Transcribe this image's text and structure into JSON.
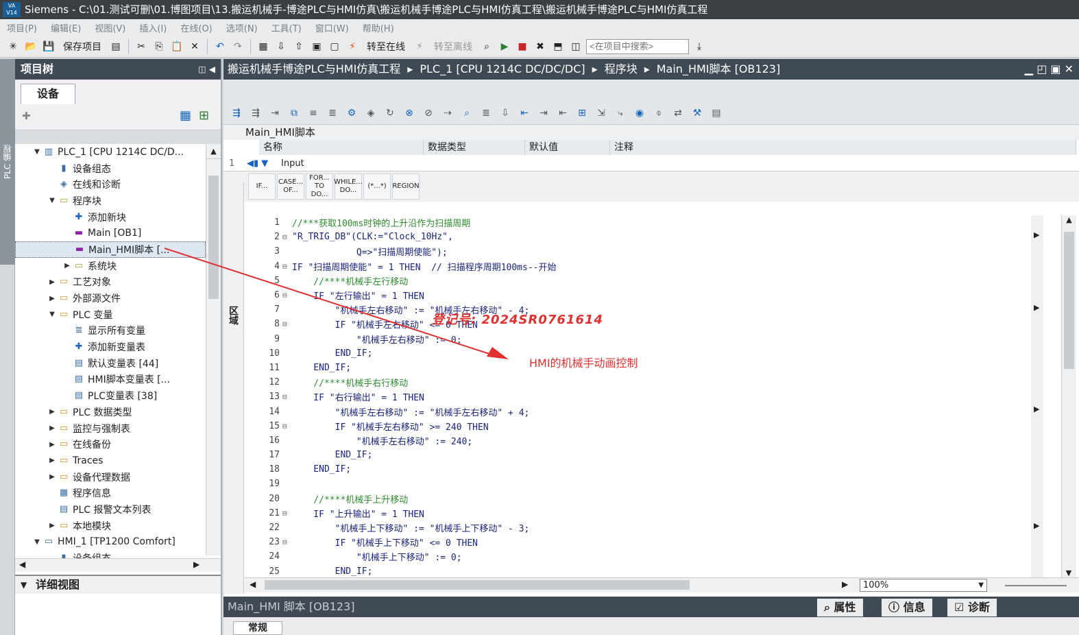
{
  "window": {
    "app_icon": "VA V14",
    "title": "Siemens  -  C:\\01.测试可删\\01.博图项目\\13.搬运机械手-博途PLC与HMI仿真\\搬运机械手博途PLC与HMI仿真工程\\搬运机械手博途PLC与HMI仿真工程"
  },
  "menu": [
    "项目(P)",
    "编辑(E)",
    "视图(V)",
    "插入(I)",
    "在线(O)",
    "选项(N)",
    "工具(T)",
    "窗口(W)",
    "帮助(H)"
  ],
  "toolbar": {
    "save_project": "保存项目",
    "go_online": "转至在线",
    "go_offline": "转至离线",
    "search_placeholder": "<在项目中搜索>"
  },
  "side_tab": "PLC 编程",
  "project_tree": {
    "title": "项目树",
    "device_tab": "设备",
    "items": [
      {
        "label": "PLC_1 [CPU 1214C DC/D...",
        "icon": "plc-icon",
        "arrow": "▼",
        "level": 0
      },
      {
        "label": "设备组态",
        "icon": "device-config-icon",
        "arrow": "",
        "level": 1
      },
      {
        "label": "在线和诊断",
        "icon": "diagnostics-icon",
        "arrow": "",
        "level": 1
      },
      {
        "label": "程序块",
        "icon": "folder-icon",
        "arrow": "▼",
        "level": 1
      },
      {
        "label": "添加新块",
        "icon": "add-block-icon",
        "arrow": "",
        "level": 2
      },
      {
        "label": "Main [OB1]",
        "icon": "ob-icon",
        "arrow": "",
        "level": 2
      },
      {
        "label": "Main_HMI脚本 [...",
        "icon": "ob-icon",
        "arrow": "",
        "level": 2,
        "selected": true
      },
      {
        "label": "系统块",
        "icon": "folder-icon",
        "arrow": "▶",
        "level": 2
      },
      {
        "label": "工艺对象",
        "icon": "folder-icon",
        "arrow": "▶",
        "level": 1
      },
      {
        "label": "外部源文件",
        "icon": "folder-icon",
        "arrow": "▶",
        "level": 1
      },
      {
        "label": "PLC 变量",
        "icon": "folder-icon",
        "arrow": "▼",
        "level": 1
      },
      {
        "label": "显示所有变量",
        "icon": "tags-icon",
        "arrow": "",
        "level": 2
      },
      {
        "label": "添加新变量表",
        "icon": "add-table-icon",
        "arrow": "",
        "level": 2
      },
      {
        "label": "默认变量表 [44]",
        "icon": "tag-table-icon",
        "arrow": "",
        "level": 2
      },
      {
        "label": "HMI脚本变量表 [...",
        "icon": "tag-table-icon",
        "arrow": "",
        "level": 2
      },
      {
        "label": "PLC变量表 [38]",
        "icon": "tag-table-icon",
        "arrow": "",
        "level": 2
      },
      {
        "label": "PLC 数据类型",
        "icon": "folder-icon",
        "arrow": "▶",
        "level": 1
      },
      {
        "label": "监控与强制表",
        "icon": "folder-icon",
        "arrow": "▶",
        "level": 1
      },
      {
        "label": "在线备份",
        "icon": "folder-icon",
        "arrow": "▶",
        "level": 1
      },
      {
        "label": "Traces",
        "icon": "folder-icon",
        "arrow": "▶",
        "level": 1
      },
      {
        "label": "设备代理数据",
        "icon": "folder-icon",
        "arrow": "▶",
        "level": 1
      },
      {
        "label": "程序信息",
        "icon": "info-icon",
        "arrow": "",
        "level": 1
      },
      {
        "label": "PLC 报警文本列表",
        "icon": "list-icon",
        "arrow": "",
        "level": 1
      },
      {
        "label": "本地模块",
        "icon": "folder-icon",
        "arrow": "▶",
        "level": 1
      },
      {
        "label": "HMI_1 [TP1200 Comfort]",
        "icon": "hmi-icon",
        "arrow": "▼",
        "level": 0
      },
      {
        "label": "设备组态",
        "icon": "device-config-icon",
        "arrow": "",
        "level": 1
      }
    ],
    "detail_view": "详细视图"
  },
  "editor": {
    "breadcrumb": [
      "搬运机械手博途PLC与HMI仿真工程",
      "PLC_1 [CPU 1214C DC/DC/DC]",
      "程序块",
      "Main_HMI脚本 [OB123]"
    ],
    "block_name": "Main_HMI脚本",
    "columns": [
      "名称",
      "数据类型",
      "默认值",
      "注释"
    ],
    "interface_row": {
      "num": "1",
      "name": "Input"
    },
    "keywords": [
      "IF...",
      "CASE... OF...",
      "FOR... TO DO...",
      "WHILE... DO...",
      "(*...*)",
      "REGION"
    ],
    "side_label": "区域",
    "zoom": "100%",
    "lines": [
      {
        "n": "1",
        "f": "",
        "t": "//***获取100ms时钟的上升沿作为扫描周期",
        "c": "cm"
      },
      {
        "n": "2",
        "f": "⊟",
        "t": "\"R_TRIG_DB\"(CLK:=\"Clock_10Hz\",",
        "c": "ctext"
      },
      {
        "n": "3",
        "f": "",
        "t": "            Q=>\"扫描周期使能\");",
        "c": "ctext"
      },
      {
        "n": "4",
        "f": "⊟",
        "t": "IF \"扫描周期使能\" = 1 THEN  // 扫描程序周期100ms--开始",
        "c": "ctext"
      },
      {
        "n": "5",
        "f": "",
        "t": "    //****机械手左行移动",
        "c": "cm"
      },
      {
        "n": "6",
        "f": "⊟",
        "t": "    IF \"左行输出\" = 1 THEN",
        "c": "ctext"
      },
      {
        "n": "7",
        "f": "",
        "t": "        \"机械手左右移动\" := \"机械手左右移动\" - 4;",
        "c": "ctext"
      },
      {
        "n": "8",
        "f": "⊟",
        "t": "        IF \"机械手左右移动\" <= 0 THEN",
        "c": "ctext"
      },
      {
        "n": "9",
        "f": "",
        "t": "            \"机械手左右移动\" := 0;",
        "c": "ctext"
      },
      {
        "n": "10",
        "f": "",
        "t": "        END_IF;",
        "c": "ctext"
      },
      {
        "n": "11",
        "f": "",
        "t": "    END_IF;",
        "c": "ctext"
      },
      {
        "n": "12",
        "f": "",
        "t": "    //****机械手右行移动",
        "c": "cm"
      },
      {
        "n": "13",
        "f": "⊟",
        "t": "    IF \"右行输出\" = 1 THEN",
        "c": "ctext"
      },
      {
        "n": "14",
        "f": "",
        "t": "        \"机械手左右移动\" := \"机械手左右移动\" + 4;",
        "c": "ctext"
      },
      {
        "n": "15",
        "f": "⊟",
        "t": "        IF \"机械手左右移动\" >= 240 THEN",
        "c": "ctext"
      },
      {
        "n": "16",
        "f": "",
        "t": "            \"机械手左右移动\" := 240;",
        "c": "ctext"
      },
      {
        "n": "17",
        "f": "",
        "t": "        END_IF;",
        "c": "ctext"
      },
      {
        "n": "18",
        "f": "",
        "t": "    END_IF;",
        "c": "ctext"
      },
      {
        "n": "19",
        "f": "",
        "t": "",
        "c": "ctext"
      },
      {
        "n": "20",
        "f": "",
        "t": "    //****机械手上升移动",
        "c": "cm"
      },
      {
        "n": "21",
        "f": "⊟",
        "t": "    IF \"上升输出\" = 1 THEN",
        "c": "ctext"
      },
      {
        "n": "22",
        "f": "",
        "t": "        \"机械手上下移动\" := \"机械手上下移动\" - 3;",
        "c": "ctext"
      },
      {
        "n": "23",
        "f": "⊟",
        "t": "        IF \"机械手上下移动\" <= 0 THEN",
        "c": "ctext"
      },
      {
        "n": "24",
        "f": "",
        "t": "            \"机械手上下移动\" := 0;",
        "c": "ctext"
      },
      {
        "n": "25",
        "f": "",
        "t": "        END_IF;",
        "c": "ctext"
      }
    ]
  },
  "annotations": {
    "watermark": "登记号: 2024SR0761614",
    "arrow_note": "HMI的机械手动画控制",
    "color": "#e03030"
  },
  "properties": {
    "title": "Main_HMI 脚本 [OB123]",
    "tabs": [
      "属性",
      "信息",
      "诊断"
    ],
    "general_tab": "常规"
  }
}
